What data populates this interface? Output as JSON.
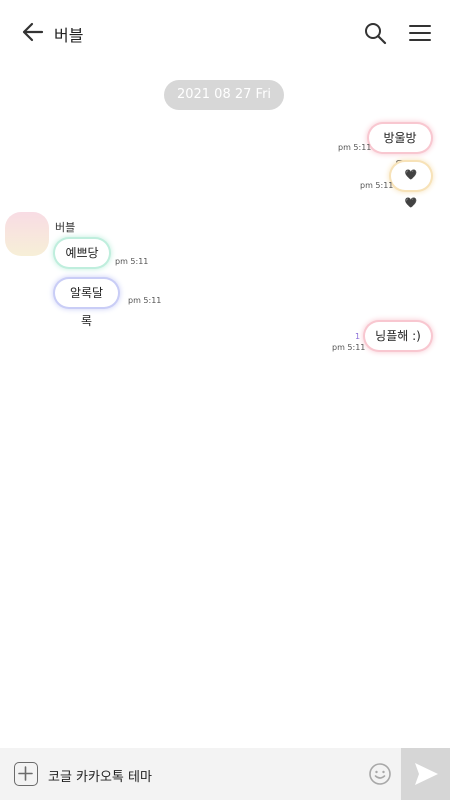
{
  "header": {
    "title": "버블"
  },
  "date_chip": "2021 08 27 Fri",
  "chat": {
    "sender_name": "버블",
    "messages": [
      {
        "side": "right",
        "text": "방울방울",
        "time": "pm 5:11",
        "glow": "#f8c7d0"
      },
      {
        "side": "right",
        "text": "🖤🖤",
        "time": "pm 5:11",
        "glow": "#f7e2b8"
      },
      {
        "side": "left",
        "text": "예쁘당",
        "time": "pm 5:11",
        "glow": "#bfeedd"
      },
      {
        "side": "left",
        "text": "알록달록",
        "time": "pm 5:11",
        "glow": "#c9cdf6"
      },
      {
        "side": "right",
        "text": "닝플해 :)",
        "time": "pm 5:11",
        "unread": "1",
        "glow": "#f8c7d0"
      }
    ]
  },
  "input": {
    "value": "코글 카카오톡 테마"
  },
  "icons": {
    "back": "back-arrow-icon",
    "search": "search-icon",
    "menu": "hamburger-menu-icon",
    "plus": "plus-icon",
    "emoji": "emoji-icon",
    "send": "send-icon"
  }
}
